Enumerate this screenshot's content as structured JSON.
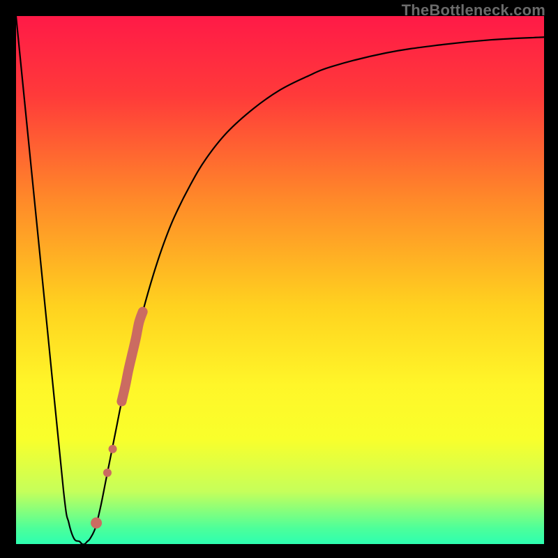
{
  "watermark": "TheBottleneck.com",
  "chart_data": {
    "type": "line",
    "title": "",
    "xlabel": "",
    "ylabel": "",
    "xlim": [
      0,
      100
    ],
    "ylim": [
      0,
      100
    ],
    "grid": false,
    "background": {
      "type": "vertical-gradient",
      "stops": [
        {
          "pos": 0.0,
          "color": "#ff1a47"
        },
        {
          "pos": 0.15,
          "color": "#ff3a3a"
        },
        {
          "pos": 0.35,
          "color": "#ff8a29"
        },
        {
          "pos": 0.55,
          "color": "#ffd21f"
        },
        {
          "pos": 0.7,
          "color": "#fff629"
        },
        {
          "pos": 0.8,
          "color": "#f9ff2b"
        },
        {
          "pos": 0.9,
          "color": "#c6ff5a"
        },
        {
          "pos": 0.97,
          "color": "#4dff9a"
        },
        {
          "pos": 1.0,
          "color": "#2dffb0"
        }
      ]
    },
    "series": [
      {
        "name": "bottleneck-curve",
        "color": "#000000",
        "x": [
          0,
          3,
          6,
          9,
          10,
          11,
          12,
          12.5,
          13,
          13.5,
          14,
          15,
          16,
          17,
          18,
          19,
          20,
          22,
          24,
          26,
          28,
          30,
          33,
          36,
          40,
          45,
          50,
          55,
          60,
          70,
          80,
          90,
          100
        ],
        "y": [
          100,
          70,
          40,
          10,
          4,
          1,
          0.5,
          0,
          0,
          0.5,
          1,
          3,
          7,
          12,
          17,
          22,
          27,
          36,
          44,
          51,
          57,
          62,
          68,
          73,
          78,
          82.5,
          86,
          88.5,
          90.5,
          93,
          94.5,
          95.5,
          96
        ]
      }
    ],
    "markers": {
      "name": "highlight-segment",
      "color": "#cb6b61",
      "points": [
        {
          "x": 15.2,
          "y": 4
        },
        {
          "x": 17.3,
          "y": 13.5
        },
        {
          "x": 18.3,
          "y": 18
        },
        {
          "x": 20.0,
          "y": 27
        },
        {
          "x": 20.7,
          "y": 30
        },
        {
          "x": 21.3,
          "y": 33
        },
        {
          "x": 22.0,
          "y": 36
        },
        {
          "x": 22.7,
          "y": 39
        },
        {
          "x": 23.3,
          "y": 42
        },
        {
          "x": 24.0,
          "y": 44
        }
      ]
    }
  }
}
